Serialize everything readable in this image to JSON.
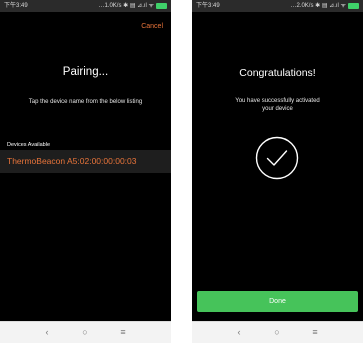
{
  "left": {
    "status": {
      "time": "下午3:49",
      "network": "…1.0K/s ✱ ▤ ⊿.ıl ᯤ"
    },
    "cancel_label": "Cancel",
    "title": "Pairing...",
    "subtitle": "Tap the device name from the below listing",
    "devices_heading": "Devices Available",
    "devices": [
      {
        "name": "ThermoBeacon A5:02:00:00:00:03"
      }
    ]
  },
  "right": {
    "status": {
      "time": "下午3:49",
      "network": "…2.0K/s ✱ ▤ ⊿.ıl ᯤ"
    },
    "title": "Congratulations!",
    "message_line1": "You have successfully activated",
    "message_line2": "your device",
    "done_label": "Done"
  },
  "nav": {
    "back": "‹",
    "home": "○",
    "menu": "≡"
  },
  "icons": {
    "battery": "battery-icon",
    "check": "check-circle-icon"
  },
  "colors": {
    "accent": "#e8743a",
    "success": "#46c35a",
    "background": "#000000"
  }
}
